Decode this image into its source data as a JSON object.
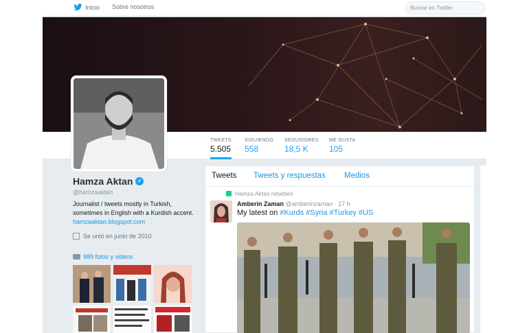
{
  "nav": {
    "home": "Inicio",
    "about": "Sobre nosotros",
    "search_placeholder": "Buscar en Twitter"
  },
  "stats": [
    {
      "label": "TWEETS",
      "value": "5.505"
    },
    {
      "label": "SIGUIENDO",
      "value": "558"
    },
    {
      "label": "SEGUIDORES",
      "value": "18,5 K"
    },
    {
      "label": "ME GUSTA",
      "value": "105"
    }
  ],
  "profile": {
    "name": "Hamza Aktan",
    "handle": "@hamzaaktan",
    "bio": "Journalist / tweets mostly in Turkish, sometimes in English with a Kurdish accent.",
    "website": "hamzaaktan.blogspot.com",
    "joined": "Se unió en junio de 2010",
    "media_link": "989 fotos y videos"
  },
  "tabs": [
    "Tweets",
    "Tweets y respuestas",
    "Medios"
  ],
  "tweet": {
    "retweet_label": "Hamza Aktan retwitteó",
    "author": "Amberin Zaman",
    "handle": "@amberinzaman",
    "time": "· 17 h",
    "text_prefix": "My latest on",
    "hashtags": "#Kurds #Syria #Turkey #US"
  },
  "colors": {
    "accent": "#1da1f2",
    "link": "#1b95e0",
    "background": "#e6ecf0"
  },
  "icons": [
    "twitter-bird-icon",
    "verified-icon",
    "calendar-icon",
    "camera-icon",
    "retweet-icon"
  ]
}
